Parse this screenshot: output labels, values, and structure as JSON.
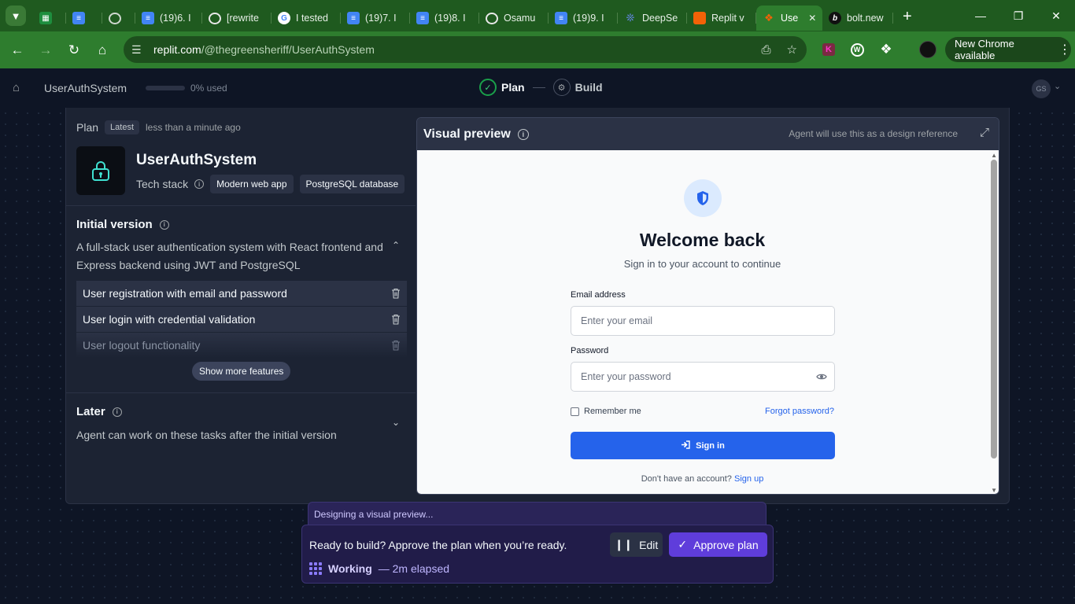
{
  "browser": {
    "tabs": [
      {
        "icon": "sheets-icon",
        "label": ""
      },
      {
        "icon": "docs-icon",
        "label": ""
      },
      {
        "icon": "globe-icon",
        "label": ""
      },
      {
        "icon": "docs-icon",
        "label": "(19)6. I"
      },
      {
        "icon": "chatgpt-icon",
        "label": "[rewrite"
      },
      {
        "icon": "google-icon",
        "label": "I tested"
      },
      {
        "icon": "docs-icon",
        "label": "(19)7. I"
      },
      {
        "icon": "docs-icon",
        "label": "(19)8. I"
      },
      {
        "icon": "chatgpt-icon",
        "label": "Osamu"
      },
      {
        "icon": "docs-icon",
        "label": "(19)9. I"
      },
      {
        "icon": "deepseek-icon",
        "label": "DeepSe"
      },
      {
        "icon": "replit-icon",
        "label": "Replit v"
      },
      {
        "icon": "replit-icon",
        "label": "Use"
      },
      {
        "icon": "bolt-icon",
        "label": "bolt.new"
      }
    ],
    "url_host": "replit.com",
    "url_path": "/@thegreensheriff/UserAuthSystem",
    "update_label": "New Chrome available"
  },
  "header": {
    "project_name": "UserAuthSystem",
    "usage": "0% used",
    "usage_fraction": 0,
    "step_plan": "Plan",
    "step_build": "Build",
    "user_initials": "GS"
  },
  "plan": {
    "label": "Plan",
    "badge": "Latest",
    "updated": "less than a minute ago",
    "app_name": "UserAuthSystem",
    "tech_stack_label": "Tech stack",
    "tech_stack": [
      "Modern web app",
      "PostgreSQL database"
    ],
    "initial_version": {
      "title": "Initial version",
      "description": "A full-stack user authentication system with React frontend and Express backend using JWT and PostgreSQL",
      "features": [
        "User registration with email and password",
        "User login with credential validation",
        "User logout functionality"
      ],
      "show_more": "Show more features"
    },
    "later": {
      "title": "Later",
      "description": "Agent can work on these tasks after the initial version"
    }
  },
  "preview": {
    "title": "Visual preview",
    "note": "Agent will use this as a design reference",
    "heading": "Welcome back",
    "subheading": "Sign in to your account to continue",
    "email_label": "Email address",
    "email_placeholder": "Enter your email",
    "password_label": "Password",
    "password_placeholder": "Enter your password",
    "remember": "Remember me",
    "forgot": "Forgot password?",
    "sign_in": "Sign in",
    "no_account": "Don't have an account?",
    "sign_up": "Sign up",
    "colors": {
      "primary": "#2563eb",
      "icon_bg": "#dbeafe"
    }
  },
  "dock": {
    "status": "Designing a visual preview...",
    "message": "Ready to build? Approve the plan when you’re ready.",
    "edit": "Edit",
    "approve": "Approve plan",
    "working": "Working",
    "elapsed": "— 2m elapsed",
    "colors": {
      "approve": "#5f3ddb"
    }
  }
}
